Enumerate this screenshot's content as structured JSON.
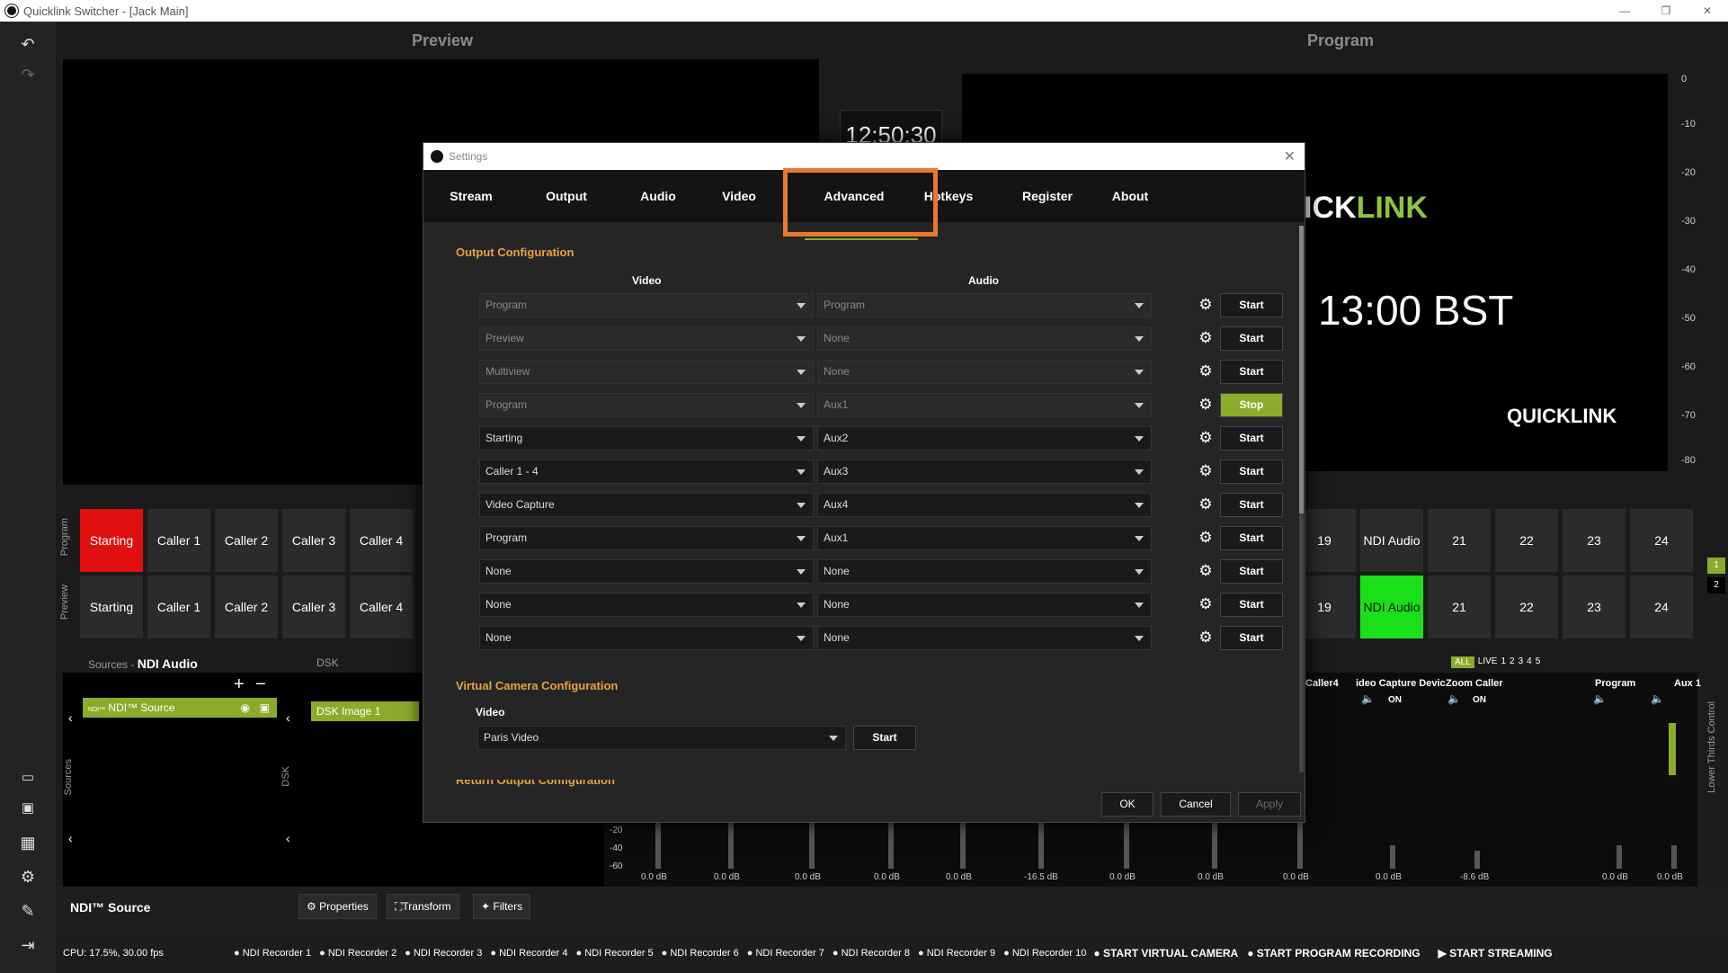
{
  "window": {
    "title": "Quicklink Switcher - [Jack Main]",
    "min": "—",
    "max": "❐",
    "close": "✕"
  },
  "panels": {
    "preview_title": "Preview",
    "program_title": "Program"
  },
  "program_display": {
    "clock": "13:00 BST",
    "brand_partial_white": "ICK",
    "brand_partial_green": "LINK",
    "brand_logo": "QUICKLINK",
    "clock_stub": "12:50:30"
  },
  "meter_scale": [
    "0",
    "-10",
    "-20",
    "-30",
    "-40",
    "-50",
    "-60",
    "-70",
    "-80"
  ],
  "rows": {
    "program_label": "Program",
    "preview_label": "Preview"
  },
  "program_buttons_left": [
    "Starting",
    "Caller 1",
    "Caller 2",
    "Caller 3",
    "Caller 4"
  ],
  "preview_buttons_left": [
    "Starting",
    "Caller 1",
    "Caller 2",
    "Caller 3",
    "Caller 4"
  ],
  "right_buttons": [
    "19",
    "NDI Audio",
    "21",
    "22",
    "23",
    "24"
  ],
  "page_badges": [
    "1",
    "2"
  ],
  "sources": {
    "header": "Sources",
    "selected": "NDI Audio",
    "item": "NDI™ Source",
    "ndi_tag": "NDI™",
    "side_label": "Sources"
  },
  "dsk": {
    "header": "DSK",
    "item": "DSK Image 1",
    "side_label": "DSK"
  },
  "mixer": {
    "filters": [
      "ALL",
      "LIVE",
      "1",
      "2",
      "3",
      "4",
      "5"
    ],
    "channels_top": [
      "Caller4",
      "ideo Capture Devic",
      "Zoom Caller",
      "Program",
      "Aux 1"
    ],
    "on_labels": [
      "ON",
      "ON"
    ],
    "scale": [
      "-20",
      "-40",
      "-60"
    ],
    "db_values": [
      "0.0 dB",
      "0.0 dB",
      "0.0 dB",
      "0.0 dB",
      "0.0 dB",
      "-16.5 dB",
      "0.0 dB",
      "0.0 dB",
      "0.0 dB",
      "0.0 dB",
      "-8.6 dB",
      "0.0 dB",
      "0.0 dB"
    ],
    "side_label": "Lower Thirds Control"
  },
  "source_footer": {
    "name": "NDI™ Source",
    "properties": "Properties",
    "transform": "Transform",
    "filters": "Filters"
  },
  "status": {
    "cpu": "CPU: 17.5%, 30.00 fps",
    "recorders": [
      "NDI Recorder 1",
      "NDI Recorder 2",
      "NDI Recorder 3",
      "NDI Recorder 4",
      "NDI Recorder 5",
      "NDI Recorder 6",
      "NDI Recorder 7",
      "NDI Recorder 8",
      "NDI Recorder 9",
      "NDI Recorder 10"
    ],
    "virtual_camera": "START VIRTUAL CAMERA",
    "program_recording": "START PROGRAM RECORDING",
    "streaming": "START STREAMING"
  },
  "dialog": {
    "title": "Settings",
    "tabs": [
      "Stream",
      "Output",
      "Audio",
      "Video",
      "Advanced",
      "Hotkeys",
      "Register",
      "About"
    ],
    "active_tab": "Advanced",
    "output_config_title": "Output Configuration",
    "col_video": "Video",
    "col_audio": "Audio",
    "rows": [
      {
        "video": "Program",
        "audio": "Program",
        "action": "Start",
        "disabled": true
      },
      {
        "video": "Preview",
        "audio": "None",
        "action": "Start",
        "disabled": true
      },
      {
        "video": "Multiview",
        "audio": "None",
        "action": "Start",
        "disabled": true
      },
      {
        "video": "Program",
        "audio": "Aux1",
        "action": "Stop",
        "disabled": true
      },
      {
        "video": "Starting",
        "audio": "Aux2",
        "action": "Start",
        "disabled": false
      },
      {
        "video": "Caller 1 - 4",
        "audio": "Aux3",
        "action": "Start",
        "disabled": false
      },
      {
        "video": "Video Capture",
        "audio": "Aux4",
        "action": "Start",
        "disabled": false
      },
      {
        "video": "Program",
        "audio": "Aux1",
        "action": "Start",
        "disabled": false
      },
      {
        "video": "None",
        "audio": "None",
        "action": "Start",
        "disabled": false
      },
      {
        "video": "None",
        "audio": "None",
        "action": "Start",
        "disabled": false
      },
      {
        "video": "None",
        "audio": "None",
        "action": "Start",
        "disabled": false
      }
    ],
    "virtual_camera_title": "Virtual Camera Configuration",
    "virtual_video_label": "Video",
    "virtual_video_value": "Paris Video",
    "virtual_start": "Start",
    "return_output_title": "Return Output Configuration",
    "ok": "OK",
    "cancel": "Cancel",
    "apply": "Apply"
  },
  "colors": {
    "accent_orange": "#e8782a",
    "accent_green": "#8bac2a",
    "program_red": "#e01010",
    "preview_green": "#19e019"
  }
}
